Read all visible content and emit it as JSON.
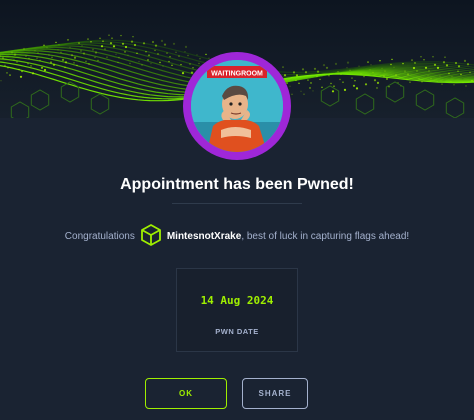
{
  "avatar": {
    "badge_text": "WAITINGROOM"
  },
  "title": "Appointment has been Pwned!",
  "message": {
    "prefix": "Congratulations",
    "username": "MintesnotXrake",
    "suffix": ", best of luck in capturing flags ahead!"
  },
  "pwn": {
    "date": "14 Aug 2024",
    "label": "PWN DATE"
  },
  "buttons": {
    "ok": "OK",
    "share": "SHARE"
  },
  "colors": {
    "accent": "#9fef00",
    "ring": "#9f27d8",
    "background": "#1a2332"
  }
}
